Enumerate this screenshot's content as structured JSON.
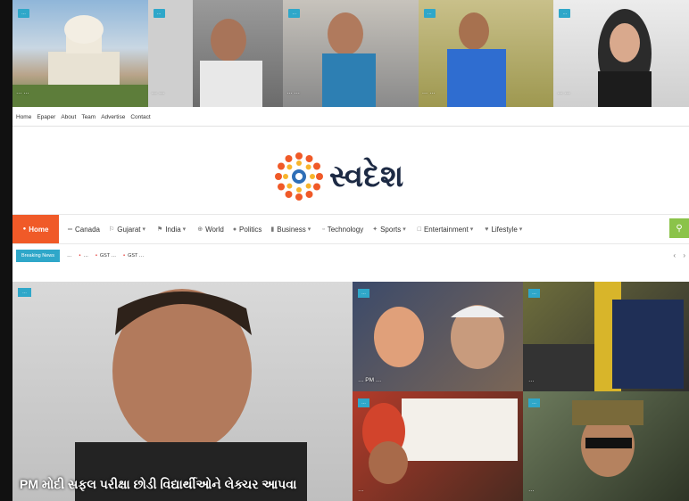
{
  "slider": [
    {
      "badge": "…",
      "caption": "… …"
    },
    {
      "badge": "…",
      "caption": "… …"
    },
    {
      "badge": "…",
      "caption": "… …"
    },
    {
      "badge": "…",
      "caption": "… …"
    },
    {
      "badge": "…",
      "caption": "… …"
    }
  ],
  "topmenu": [
    "Home",
    "Epaper",
    "About",
    "Team",
    "Advertise",
    "Contact"
  ],
  "logo": {
    "text": "સ્વદેશ"
  },
  "nav": {
    "home": "Home",
    "items": [
      {
        "icon": "flag-icon",
        "label": "Canada",
        "dropdown": false
      },
      {
        "icon": "flag-icon",
        "label": "Gujarat",
        "dropdown": true
      },
      {
        "icon": "flag-icon",
        "label": "India",
        "dropdown": true
      },
      {
        "icon": "globe-icon",
        "label": "World",
        "dropdown": false
      },
      {
        "icon": "dot-icon",
        "label": "Politics",
        "dropdown": false
      },
      {
        "icon": "chart-icon",
        "label": "Business",
        "dropdown": true
      },
      {
        "icon": "chip-icon",
        "label": "Technology",
        "dropdown": false
      },
      {
        "icon": "trophy-icon",
        "label": "Sports",
        "dropdown": true
      },
      {
        "icon": "screen-icon",
        "label": "Entertainment",
        "dropdown": true
      },
      {
        "icon": "heart-icon",
        "label": "Lifestyle",
        "dropdown": true
      }
    ]
  },
  "ticker": {
    "label": "Breaking News",
    "items": [
      {
        "text": "…"
      },
      {
        "text": "…"
      },
      {
        "text": "GST …"
      },
      {
        "text": "GST …"
      }
    ]
  },
  "main": {
    "big": {
      "badge": "…",
      "headline": "PM મોદી સફલ પરીક્ષા છોડી વિદ્યાર્થીઓને લેક્ચર આપવા"
    },
    "tiles": [
      {
        "badge": "…",
        "caption": "… PM …"
      },
      {
        "badge": "…",
        "caption": "…"
      },
      {
        "badge": "…",
        "caption": "…"
      },
      {
        "badge": "…",
        "caption": "…"
      }
    ]
  },
  "colors": {
    "accent": "#f05a28",
    "badge": "#2fa7c9",
    "search": "#8bc34a",
    "logo": "#1d2a44"
  }
}
